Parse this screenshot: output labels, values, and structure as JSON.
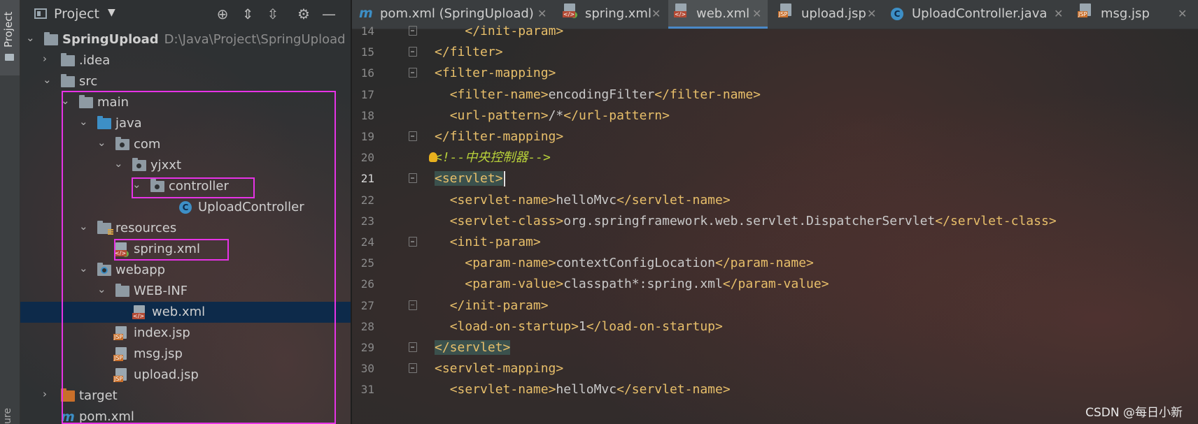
{
  "sidebar_strip": {
    "project_label": "Project",
    "bottom_label": "ure"
  },
  "project_panel": {
    "title": "Project",
    "tree": [
      {
        "label": "SpringUpload",
        "path": "D:\\Java\\Project\\SpringUpload"
      },
      {
        "label": ".idea"
      },
      {
        "label": "src"
      },
      {
        "label": "main"
      },
      {
        "label": "java"
      },
      {
        "label": "com"
      },
      {
        "label": "yjxxt"
      },
      {
        "label": "controller"
      },
      {
        "label": "UploadController"
      },
      {
        "label": "resources"
      },
      {
        "label": "spring.xml"
      },
      {
        "label": "webapp"
      },
      {
        "label": "WEB-INF"
      },
      {
        "label": "web.xml"
      },
      {
        "label": "index.jsp"
      },
      {
        "label": "msg.jsp"
      },
      {
        "label": "upload.jsp"
      },
      {
        "label": "target"
      },
      {
        "label": "pom.xml"
      }
    ]
  },
  "tabs": [
    {
      "label": "pom.xml (SpringUpload)",
      "icon": "maven-icon"
    },
    {
      "label": "spring.xml",
      "icon": "spring-xml-icon"
    },
    {
      "label": "web.xml",
      "icon": "xml-file-icon"
    },
    {
      "label": "upload.jsp",
      "icon": "jsp-file-icon"
    },
    {
      "label": "UploadController.java",
      "icon": "class-icon"
    },
    {
      "label": "msg.jsp",
      "icon": "jsp-file-icon"
    }
  ],
  "editor": {
    "active_tab": "web.xml",
    "current_line": "21",
    "lines": [
      {
        "n": "14",
        "parts": [
          {
            "t": "    ",
            "c": "txt"
          },
          {
            "t": "</init-param>",
            "c": "tag"
          }
        ]
      },
      {
        "n": "15",
        "parts": [
          {
            "t": "</filter>",
            "c": "tag"
          }
        ]
      },
      {
        "n": "16",
        "parts": [
          {
            "t": "<filter-mapping>",
            "c": "tag"
          }
        ]
      },
      {
        "n": "17",
        "parts": [
          {
            "t": "  ",
            "c": "txt"
          },
          {
            "t": "<filter-name>",
            "c": "tag"
          },
          {
            "t": "encodingFilter",
            "c": "txt"
          },
          {
            "t": "</filter-name>",
            "c": "tag"
          }
        ]
      },
      {
        "n": "18",
        "parts": [
          {
            "t": "  ",
            "c": "txt"
          },
          {
            "t": "<url-pattern>",
            "c": "tag"
          },
          {
            "t": "/*",
            "c": "txt"
          },
          {
            "t": "</url-pattern>",
            "c": "tag"
          }
        ]
      },
      {
        "n": "19",
        "parts": [
          {
            "t": "</filter-mapping>",
            "c": "tag"
          }
        ]
      },
      {
        "n": "20",
        "parts": [
          {
            "t": "<!--中央控制器-->",
            "c": "cmt"
          }
        ]
      },
      {
        "n": "21",
        "parts": [
          {
            "t": "<servlet>",
            "c": "tag tag-hl"
          }
        ]
      },
      {
        "n": "22",
        "parts": [
          {
            "t": "  ",
            "c": "txt"
          },
          {
            "t": "<servlet-name>",
            "c": "tag"
          },
          {
            "t": "helloMvc",
            "c": "txt"
          },
          {
            "t": "</servlet-name>",
            "c": "tag"
          }
        ]
      },
      {
        "n": "23",
        "parts": [
          {
            "t": "  ",
            "c": "txt"
          },
          {
            "t": "<servlet-class>",
            "c": "tag"
          },
          {
            "t": "org.springframework.web.servlet.DispatcherServlet",
            "c": "txt"
          },
          {
            "t": "</servlet-class>",
            "c": "tag"
          }
        ]
      },
      {
        "n": "24",
        "parts": [
          {
            "t": "  ",
            "c": "txt"
          },
          {
            "t": "<init-param>",
            "c": "tag"
          }
        ]
      },
      {
        "n": "25",
        "parts": [
          {
            "t": "    ",
            "c": "txt"
          },
          {
            "t": "<param-name>",
            "c": "tag"
          },
          {
            "t": "contextConfigLocation",
            "c": "txt"
          },
          {
            "t": "</param-name>",
            "c": "tag"
          }
        ]
      },
      {
        "n": "26",
        "parts": [
          {
            "t": "    ",
            "c": "txt"
          },
          {
            "t": "<param-value>",
            "c": "tag"
          },
          {
            "t": "classpath*:spring.xml",
            "c": "txt"
          },
          {
            "t": "</param-value>",
            "c": "tag"
          }
        ]
      },
      {
        "n": "27",
        "parts": [
          {
            "t": "  ",
            "c": "txt"
          },
          {
            "t": "</init-param>",
            "c": "tag"
          }
        ]
      },
      {
        "n": "28",
        "parts": [
          {
            "t": "  ",
            "c": "txt"
          },
          {
            "t": "<load-on-startup>",
            "c": "tag"
          },
          {
            "t": "1",
            "c": "txt"
          },
          {
            "t": "</load-on-startup>",
            "c": "tag"
          }
        ]
      },
      {
        "n": "29",
        "parts": [
          {
            "t": "</servlet>",
            "c": "tag tag-hl"
          }
        ]
      },
      {
        "n": "30",
        "parts": [
          {
            "t": "<servlet-mapping>",
            "c": "tag"
          }
        ]
      },
      {
        "n": "31",
        "parts": [
          {
            "t": "  ",
            "c": "txt"
          },
          {
            "t": "<servlet-name>",
            "c": "tag"
          },
          {
            "t": "helloMvc",
            "c": "txt"
          },
          {
            "t": "</servlet-name>",
            "c": "tag"
          }
        ]
      }
    ]
  },
  "watermark": "CSDN @每日小新",
  "colors": {
    "tag": "#e8bf6a",
    "comment": "#b9d23a",
    "highlight_box": "#e633e6",
    "selection": "#0d2a4a"
  }
}
